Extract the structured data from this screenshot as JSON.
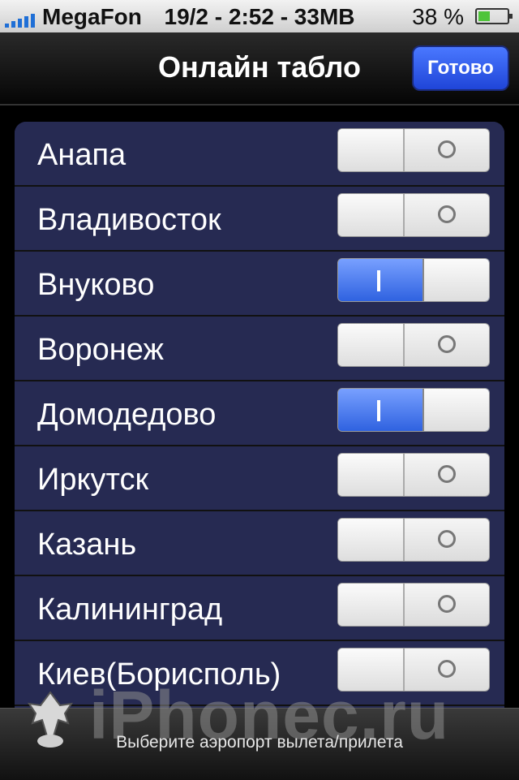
{
  "status": {
    "carrier": "MegaFon",
    "center": "19/2 - 2:52 - 33MB",
    "battery_pct": "38 %"
  },
  "navbar": {
    "title": "Онлайн табло",
    "done_label": "Готово"
  },
  "airports": [
    {
      "name": "Анапа",
      "on": false
    },
    {
      "name": "Владивосток",
      "on": false
    },
    {
      "name": "Внуково",
      "on": true
    },
    {
      "name": "Воронеж",
      "on": false
    },
    {
      "name": "Домодедово",
      "on": true
    },
    {
      "name": "Иркутск",
      "on": false
    },
    {
      "name": "Казань",
      "on": false
    },
    {
      "name": "Калининград",
      "on": false
    },
    {
      "name": "Киев(Борисполь)",
      "on": false
    }
  ],
  "bottom": {
    "hint": "Выберите аэропорт вылета/прилета",
    "watermark": "iPhonec.ru"
  }
}
